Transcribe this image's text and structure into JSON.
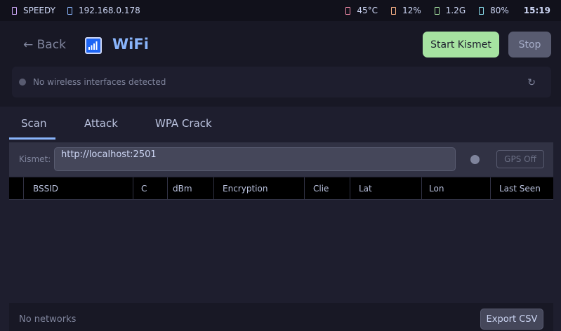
{
  "statusbar": {
    "hostname": "SPEEDY",
    "ip": "192.168.0.178",
    "temp": "45°C",
    "cpu": "12%",
    "mem": "1.2G",
    "battery": "80%",
    "time": "15:19",
    "colors": {
      "hostname": "#cba6f7",
      "ip": "#89b4fa",
      "temp": "#f38ba8",
      "cpu": "#fab387",
      "mem": "#a6e3a1",
      "battery": "#89dceb"
    }
  },
  "header": {
    "back_label": "← Back",
    "title": "WiFi",
    "app_icon": "wifi-signal-icon",
    "start_label": "Start Kismet",
    "stop_label": "Stop"
  },
  "interfaces": {
    "status_text": "No wireless interfaces detected",
    "refresh_icon": "↻"
  },
  "tabs": [
    {
      "label": "Scan",
      "active": true
    },
    {
      "label": "Attack",
      "active": false
    },
    {
      "label": "WPA Crack",
      "active": false
    }
  ],
  "kismet": {
    "label": "Kismet:",
    "url": "http://localhost:2501",
    "gps_label": "GPS Off"
  },
  "table": {
    "columns": [
      "",
      "BSSID",
      "C",
      "dBm",
      "Encryption",
      "Clie",
      "Lat",
      "Lon",
      "Last Seen"
    ]
  },
  "footer": {
    "status": "No networks",
    "export_label": "Export CSV"
  },
  "colors": {
    "accent": "#89b4fa",
    "start": "#a6e3a1",
    "stop": "#585b70",
    "background": "#1e1e2e"
  }
}
